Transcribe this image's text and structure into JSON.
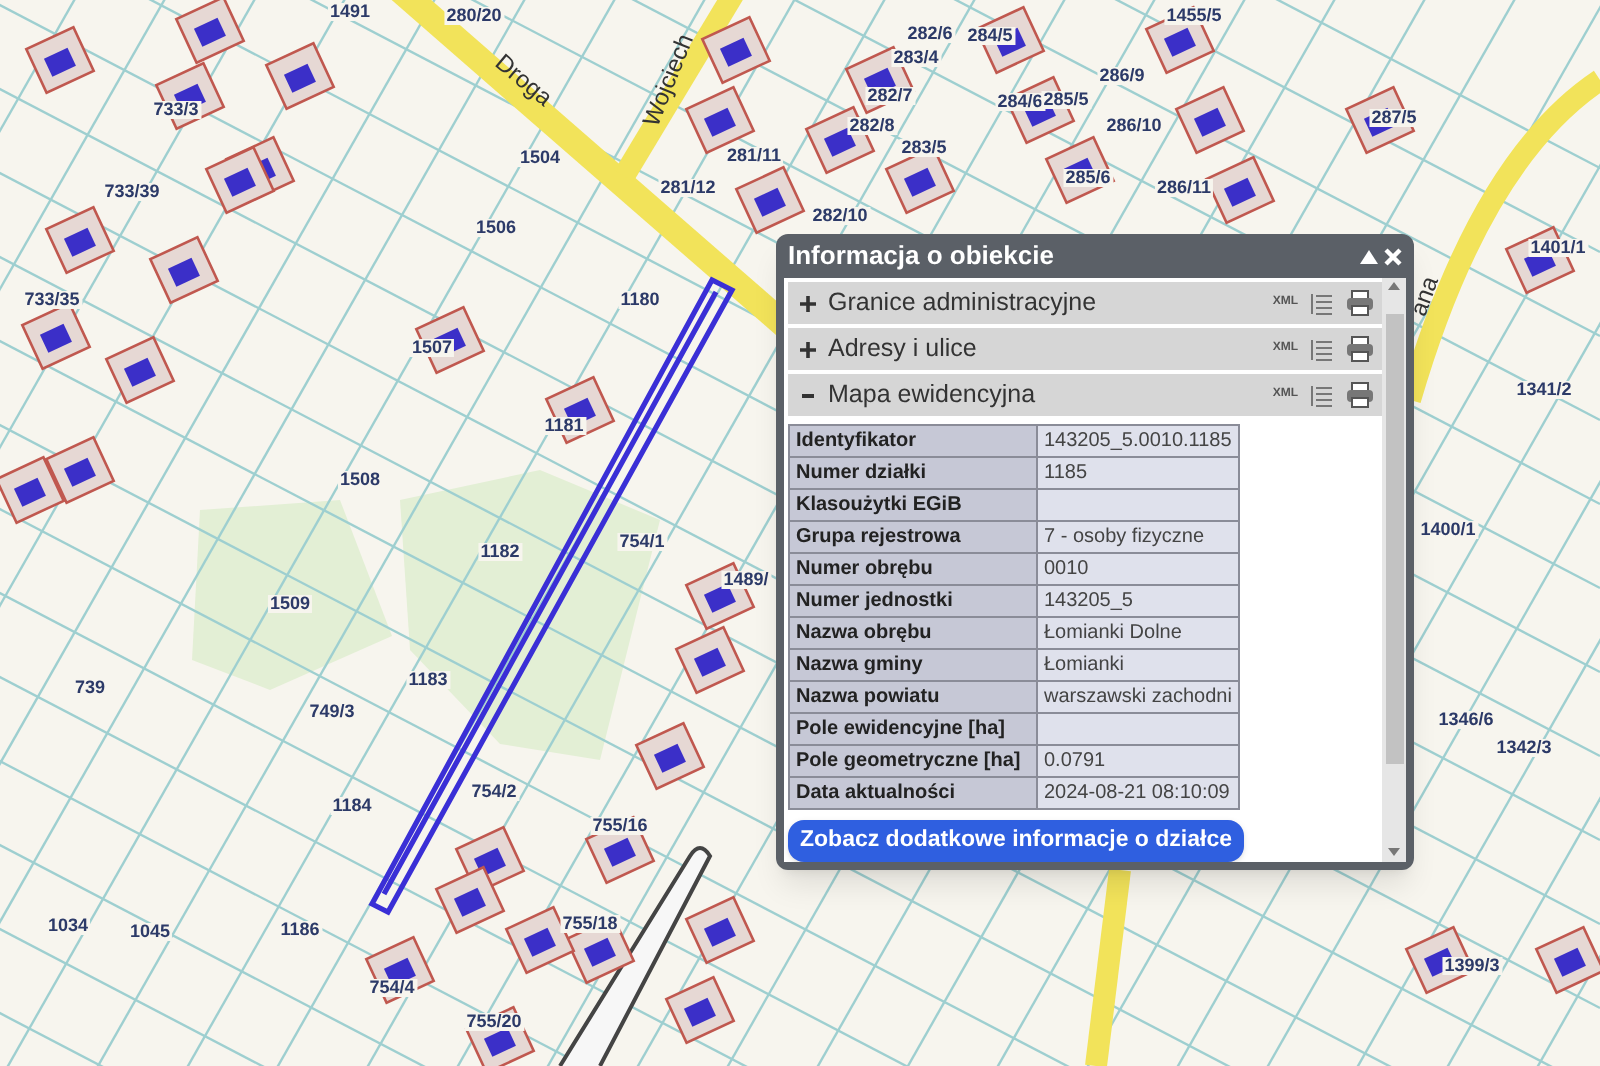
{
  "map": {
    "parcel_labels": [
      "1491",
      "280/20",
      "733/3",
      "733/39",
      "733/35",
      "1504",
      "1506",
      "281/12",
      "281/11",
      "1180",
      "1507",
      "1181",
      "1508",
      "1182",
      "754/1",
      "1489/",
      "1509",
      "1183",
      "739",
      "749/3",
      "1184",
      "754/2",
      "755/16",
      "1034",
      "1045",
      "1186",
      "755/18",
      "754/4",
      "755/20",
      "282/6",
      "283/4",
      "282/7",
      "282/8",
      "283/5",
      "282/10",
      "284/5",
      "284/6",
      "285/5",
      "285/6",
      "286/9",
      "286/10",
      "286/11",
      "1455/5",
      "287/5",
      "1401/1",
      "1341/2",
      "1400/1",
      "1346/6",
      "1342/3",
      "1399/3"
    ],
    "road_labels": [
      "Droga",
      "Wojciech",
      "ana"
    ]
  },
  "popup": {
    "title": "Informacja o obiekcie",
    "sections": [
      {
        "label": "Granice administracyjne",
        "expanded": false,
        "xml": "XML"
      },
      {
        "label": "Adresy i ulice",
        "expanded": false,
        "xml": "XML"
      },
      {
        "label": "Mapa ewidencyjna",
        "expanded": true,
        "xml": "XML"
      }
    ],
    "rows": [
      {
        "label": "Identyfikator",
        "value": "143205_5.0010.1185"
      },
      {
        "label": "Numer działki",
        "value": "1185"
      },
      {
        "label": "Klasoużytki EGiB",
        "value": ""
      },
      {
        "label": "Grupa rejestrowa",
        "value": "7 - osoby fizyczne"
      },
      {
        "label": "Numer obrębu",
        "value": "0010"
      },
      {
        "label": "Numer jednostki",
        "value": "143205_5"
      },
      {
        "label": "Nazwa obrębu",
        "value": "Łomianki Dolne"
      },
      {
        "label": "Nazwa gminy",
        "value": "Łomianki"
      },
      {
        "label": "Nazwa powiatu",
        "value": "warszawski zachodni"
      },
      {
        "label": "Pole ewidencyjne [ha]",
        "value": ""
      },
      {
        "label": "Pole geometryczne [ha]",
        "value": "0.0791"
      },
      {
        "label": "Data aktualności",
        "value": "2024-08-21 08:10:09"
      }
    ],
    "button": "Zobacz dodatkowe informacje o działce"
  }
}
